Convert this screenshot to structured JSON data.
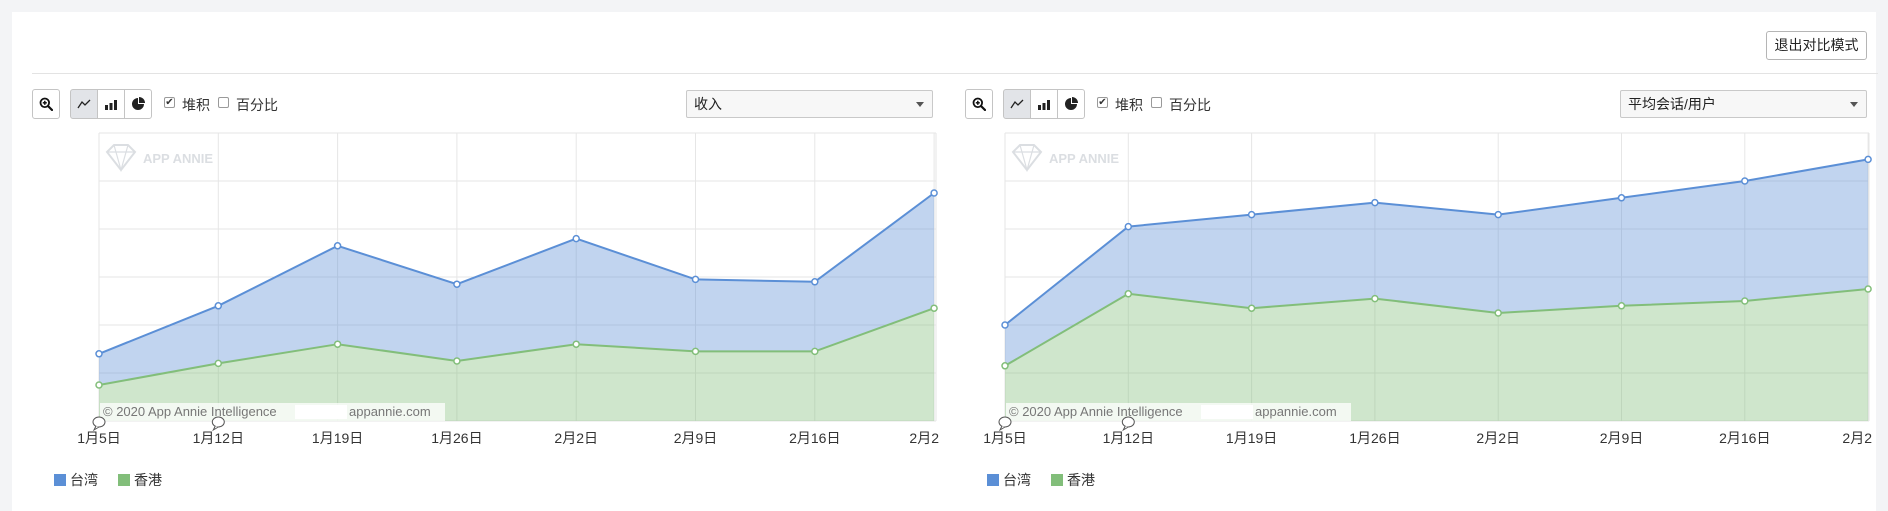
{
  "toolbar": {
    "exit_compare_label": "退出对比模式"
  },
  "icons": [
    "zoom-in-icon",
    "line-chart-icon",
    "bar-chart-icon",
    "pie-chart-icon"
  ],
  "colors": {
    "taiwan": "#5b8fd6",
    "hongkong": "#82be7a"
  },
  "watermark": {
    "brand": "APP ANNIE"
  },
  "panels": [
    {
      "stacked_label": "堆积",
      "stacked_checked": true,
      "percent_label": "百分比",
      "percent_checked": false,
      "metric": "收入",
      "copyright_left": "© 2020 App Annie Intelligence",
      "copyright_right": "appannie.com",
      "legend": [
        {
          "label": "台湾"
        },
        {
          "label": "香港"
        }
      ]
    },
    {
      "stacked_label": "堆积",
      "stacked_checked": true,
      "percent_label": "百分比",
      "percent_checked": false,
      "metric": "平均会话/用户",
      "copyright_left": "© 2020 App Annie Intelligence",
      "copyright_right": "appannie.com",
      "legend": [
        {
          "label": "台湾"
        },
        {
          "label": "香港"
        }
      ]
    }
  ],
  "chart_data": [
    {
      "type": "area",
      "stacked": true,
      "grid": true,
      "ylim": [
        0,
        6
      ],
      "x": [
        "1月5日",
        "1月12日",
        "1月19日",
        "1月26日",
        "2月2日",
        "2月9日",
        "2月16日",
        "2月2"
      ],
      "series": [
        {
          "name": "台湾",
          "values": [
            0.65,
            1.2,
            2.05,
            1.6,
            2.2,
            1.5,
            1.45,
            2.4
          ]
        },
        {
          "name": "香港",
          "values": [
            0.75,
            1.2,
            1.6,
            1.25,
            1.6,
            1.45,
            1.45,
            2.35
          ]
        }
      ]
    },
    {
      "type": "area",
      "stacked": true,
      "grid": true,
      "ylim": [
        0,
        6
      ],
      "x": [
        "1月5日",
        "1月12日",
        "1月19日",
        "1月26日",
        "2月2日",
        "2月9日",
        "2月16日",
        "2月2"
      ],
      "series": [
        {
          "name": "台湾",
          "values": [
            0.85,
            1.4,
            1.95,
            2.0,
            2.05,
            2.25,
            2.5,
            2.7
          ]
        },
        {
          "name": "香港",
          "values": [
            1.15,
            2.65,
            2.35,
            2.55,
            2.25,
            2.4,
            2.5,
            2.75
          ]
        }
      ]
    }
  ]
}
